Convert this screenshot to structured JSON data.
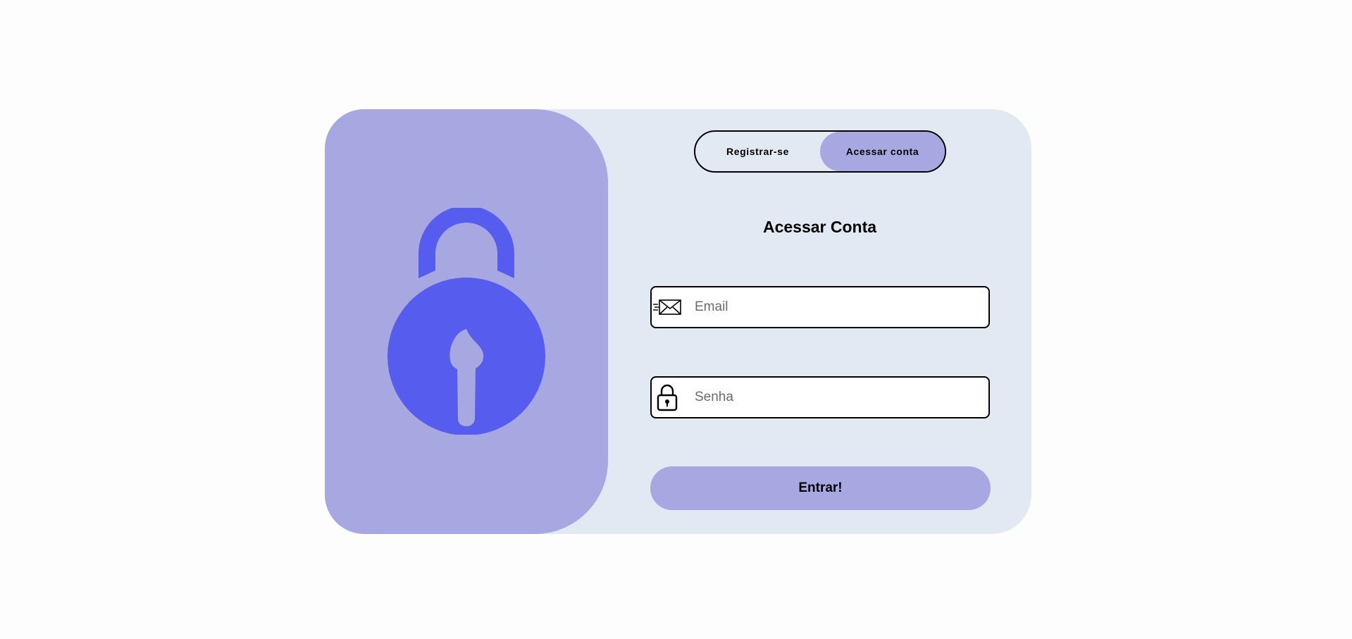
{
  "colors": {
    "page_background": "#fdfdfd",
    "card_background": "#e3e9f2",
    "accent": "#a7a8e1",
    "lock_blue": "#565cee"
  },
  "illustration": {
    "icon": "padlock-icon"
  },
  "toggle": {
    "register_label": "Registrar-se",
    "login_label": "Acessar conta",
    "active": "login"
  },
  "form": {
    "title": "Acessar Conta",
    "email": {
      "icon": "envelope-icon",
      "placeholder": "Email",
      "value": ""
    },
    "password": {
      "icon": "lock-icon",
      "placeholder": "Senha",
      "value": ""
    },
    "submit_label": "Entrar!"
  }
}
